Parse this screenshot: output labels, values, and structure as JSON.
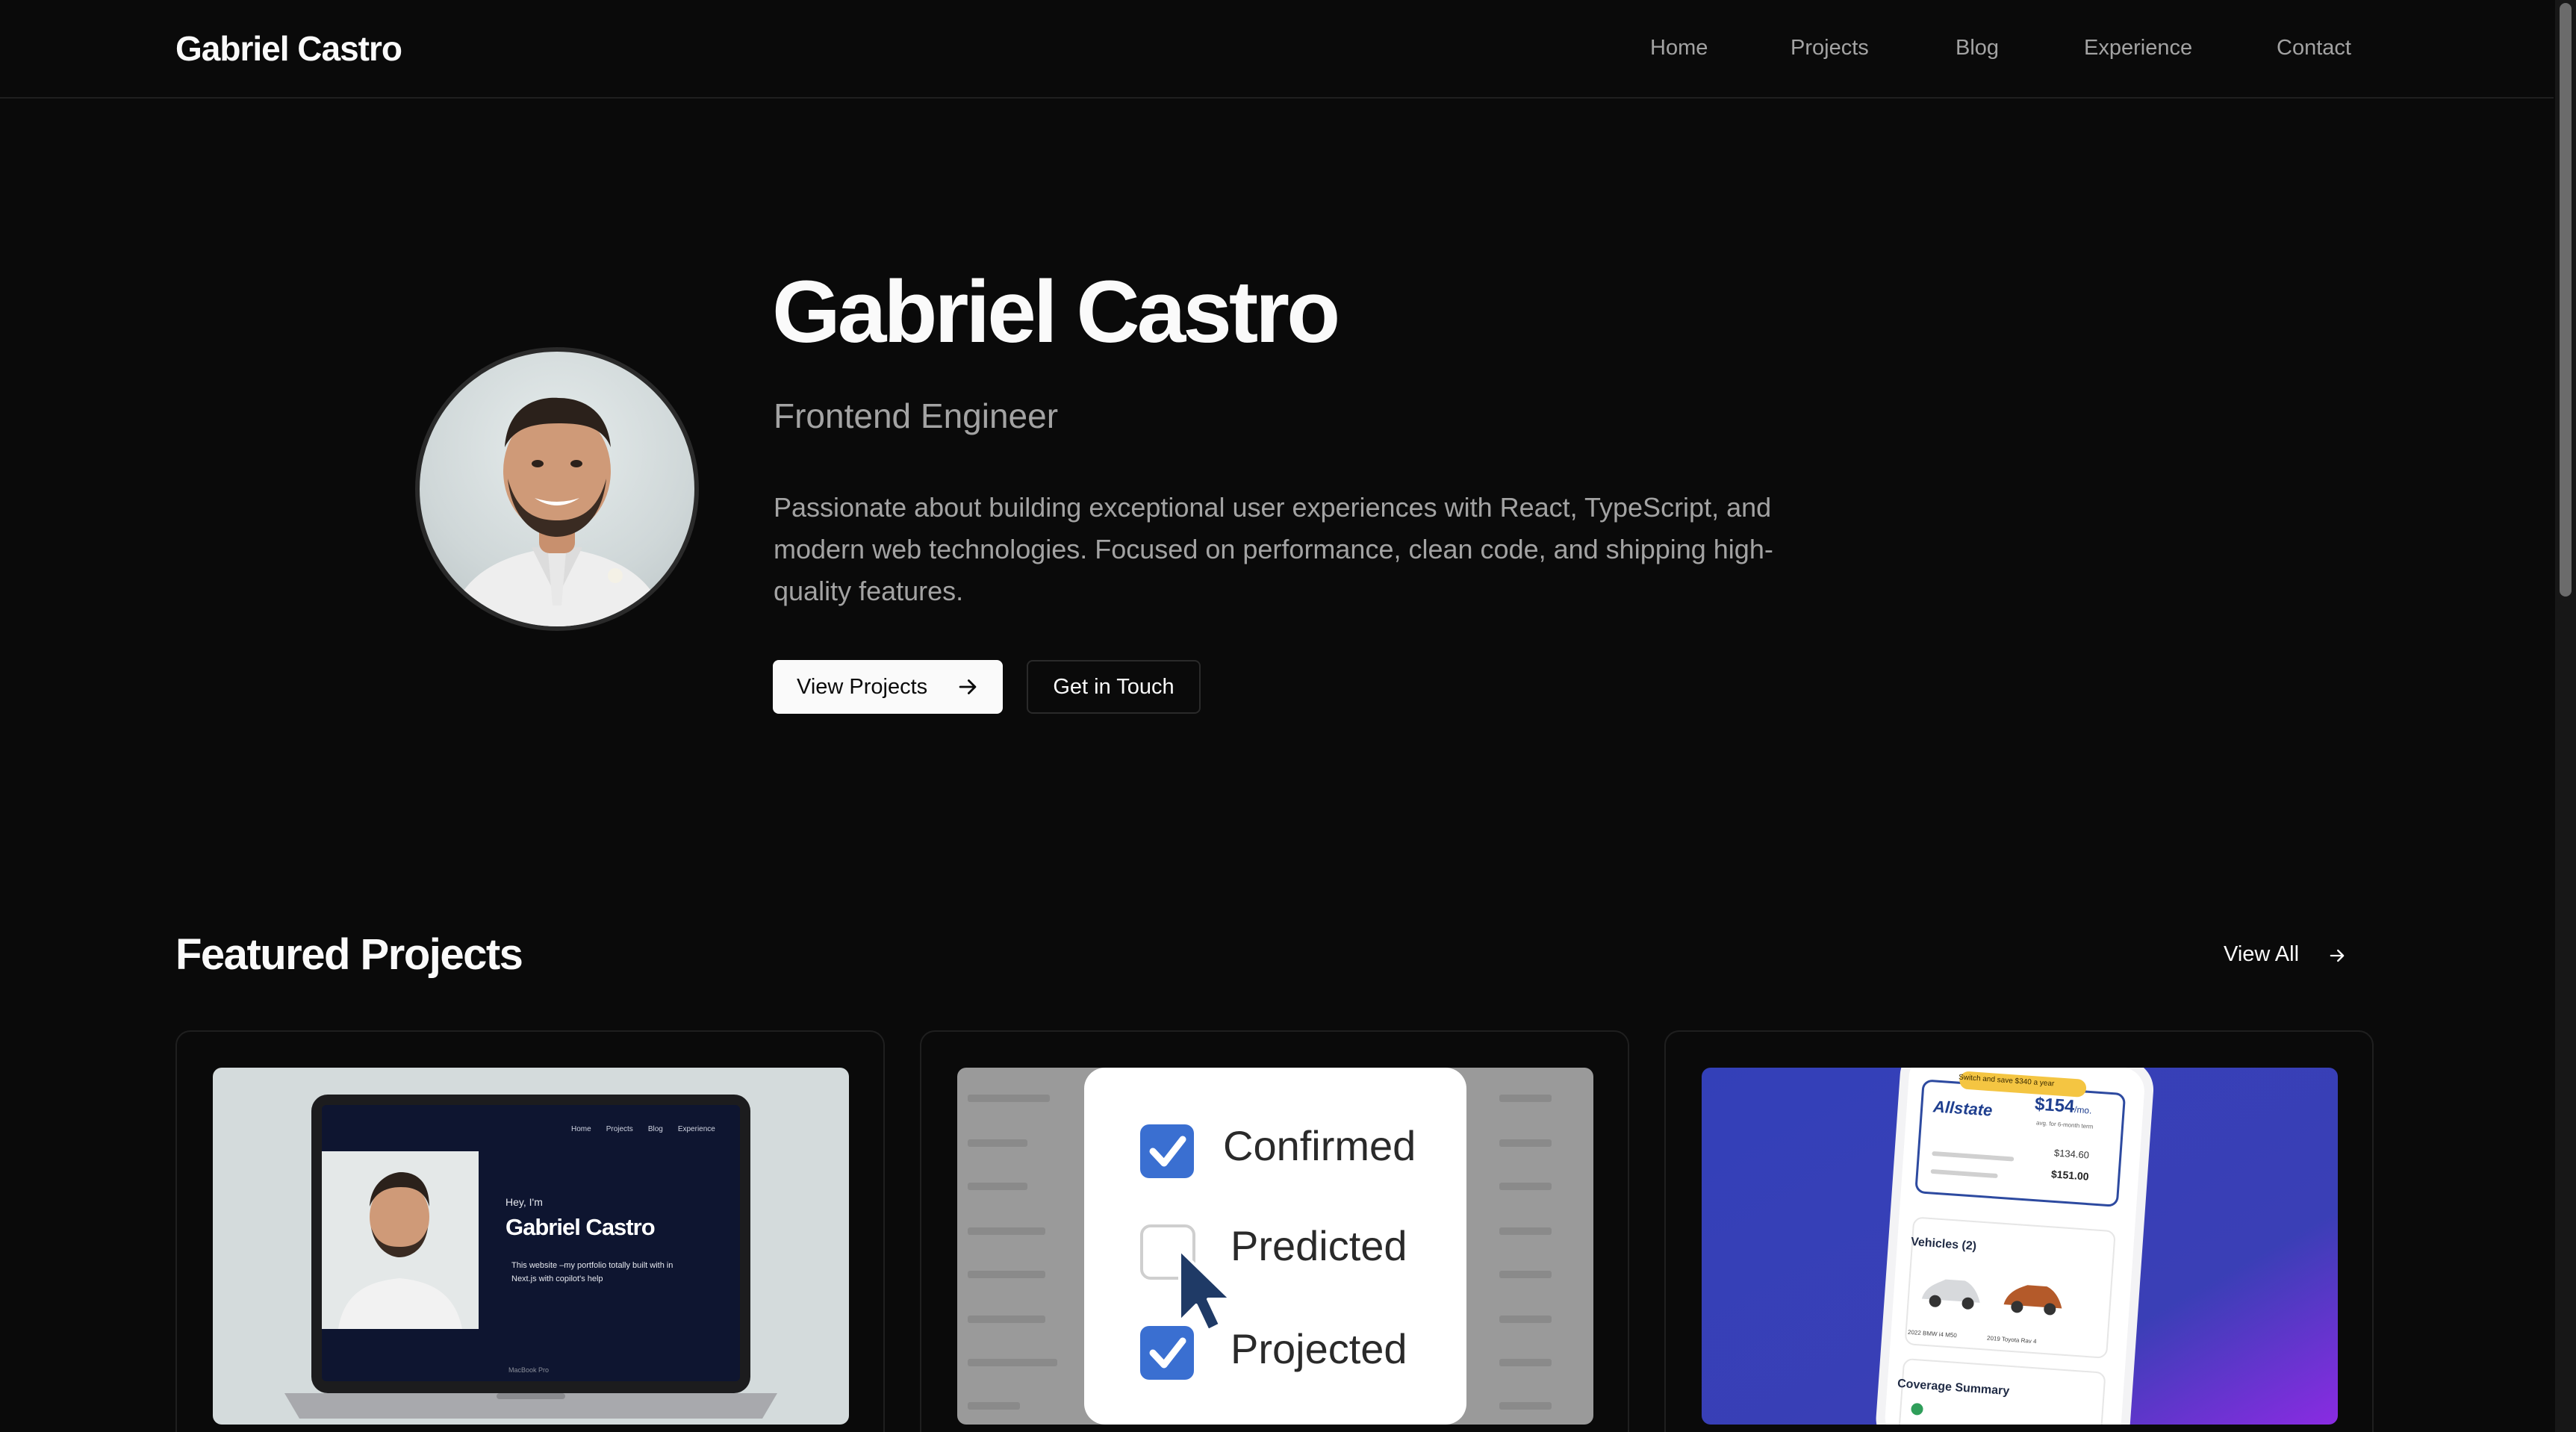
{
  "nav": {
    "logo": "Gabriel Castro",
    "links": [
      "Home",
      "Projects",
      "Blog",
      "Experience",
      "Contact"
    ]
  },
  "hero": {
    "name": "Gabriel Castro",
    "role": "Frontend Engineer",
    "description": "Passionate about building exceptional user experiences with React, TypeScript, and modern web technologies. Focused on performance, clean code, and shipping high-quality features.",
    "primary_button": "View Projects",
    "secondary_button": "Get in Touch"
  },
  "featured": {
    "title": "Featured Projects",
    "view_all": "View All",
    "cards": [
      {
        "thumb": "laptop-portfolio",
        "nav_items": [
          "Home",
          "Projects",
          "Blog",
          "Experience"
        ],
        "greeting": "Hey, I'm",
        "name": "Gabriel Castro",
        "tagline_1": "This website –my portfolio totally built with in",
        "tagline_2": "Next.js with copilot's help",
        "laptop_label": "MacBook Pro"
      },
      {
        "thumb": "checkbox-states",
        "options": [
          {
            "label": "Confirmed",
            "checked": true
          },
          {
            "label": "Predicted",
            "checked": false
          },
          {
            "label": "Projected",
            "checked": true
          }
        ]
      },
      {
        "thumb": "insurance-app",
        "banner": "Switch and save $340 a year",
        "brand": "Allstate",
        "price": "$154",
        "price_unit": "/mo.",
        "price_note": "avg. for 6-month term",
        "line_1": "$134.60",
        "line_2": "$151.00",
        "vehicles_title": "Vehicles (2)",
        "vehicle_1": "2022 BMW i4 M50",
        "vehicle_2": "2019 Toyota Rav 4",
        "coverage": "Coverage Summary"
      }
    ]
  },
  "colors": {
    "background": "#0a0a0a",
    "text": "#fafafa",
    "muted": "#a3a3a3",
    "border": "#1f1f1f",
    "accent_blue": "#3340b8"
  }
}
